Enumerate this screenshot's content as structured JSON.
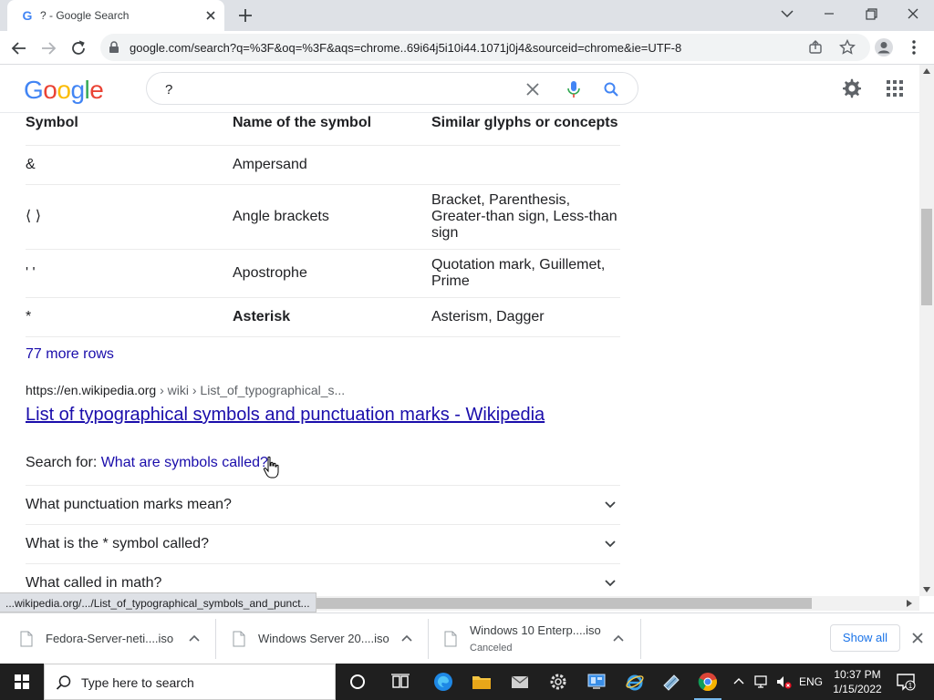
{
  "browser": {
    "tab_title": "? - Google Search",
    "tab_favicon": "G",
    "url": "google.com/search?q=%3F&oq=%3F&aqs=chrome..69i64j5i10i44.1071j0j4&sourceid=chrome&ie=UTF-8",
    "status_url": "...wikipedia.org/.../List_of_typographical_symbols_and_punct..."
  },
  "google": {
    "logo_letters": [
      {
        "ch": "G",
        "color": "#4285f4"
      },
      {
        "ch": "o",
        "color": "#ea4335"
      },
      {
        "ch": "o",
        "color": "#fbbc05"
      },
      {
        "ch": "g",
        "color": "#4285f4"
      },
      {
        "ch": "l",
        "color": "#34a853"
      },
      {
        "ch": "e",
        "color": "#ea4335"
      }
    ],
    "search_value": "?"
  },
  "table": {
    "headers": [
      "Symbol",
      "Name of the symbol",
      "Similar glyphs or concepts"
    ],
    "rows": [
      {
        "symbol": "&",
        "name": "Ampersand",
        "similar": "",
        "bold": false
      },
      {
        "symbol": "⟨ ⟩",
        "name": "Angle brackets",
        "similar": "Bracket, Parenthesis, Greater-than sign, Less-than sign",
        "bold": false
      },
      {
        "symbol": "' '",
        "name": "Apostrophe",
        "similar": "Quotation mark, Guillemet, Prime",
        "bold": false
      },
      {
        "symbol": "*",
        "name": "Asterisk",
        "similar": "Asterism, Dagger",
        "bold": true
      }
    ]
  },
  "result": {
    "more_rows": "77 more rows",
    "cite_domain": "https://en.wikipedia.org",
    "cite_path": " › wiki › List_of_typographical_s...",
    "title": "List of typographical symbols and punctuation marks - Wikipedia",
    "search_for_label": "Search for: ",
    "search_for_link": "What are symbols called?"
  },
  "people_also_ask": [
    "What punctuation marks mean?",
    "What is the * symbol called?",
    "What called in math?"
  ],
  "downloads": [
    {
      "name": "Fedora-Server-neti....iso",
      "status": ""
    },
    {
      "name": "Windows Server 20....iso",
      "status": ""
    },
    {
      "name": "Windows 10 Enterp....iso",
      "status": "Canceled"
    }
  ],
  "downloads_show_all": "Show all",
  "taskbar": {
    "search_placeholder": "Type here to search",
    "lang": "ENG",
    "time": "10:37 PM",
    "date": "1/15/2022",
    "notification_count": "1"
  },
  "colors": {
    "link": "#1a0dab",
    "chrome_frame": "#dee1e6",
    "taskbar": "#1f1f1f"
  }
}
